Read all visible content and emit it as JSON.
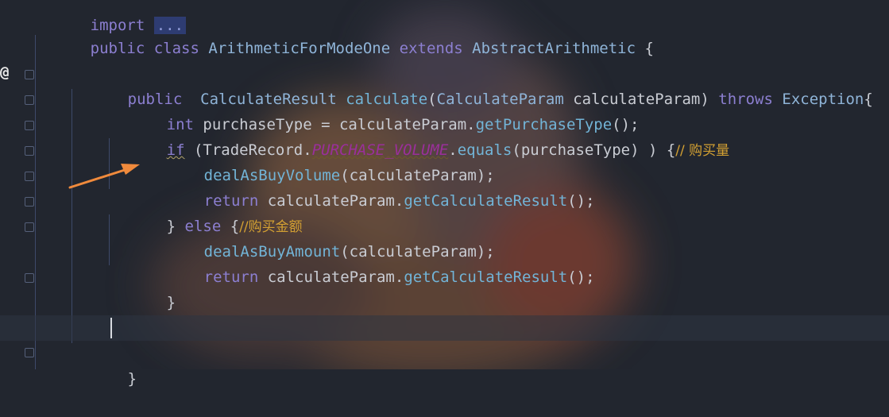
{
  "editor": {
    "gutter": {
      "override_marker": "@"
    },
    "lines": {
      "import": {
        "kw": "import",
        "folded": "..."
      },
      "class_decl": {
        "kw1": "public",
        "kw2": "class",
        "name": "ArithmeticForModeOne",
        "kw3": "extends",
        "base": "AbstractArithmetic",
        "brace": " {"
      },
      "method_decl": {
        "kw": "public",
        "ret": "CalculateResult",
        "name": "calculate",
        "open": "(",
        "ptype": "CalculateParam",
        "pname": " calculateParam",
        "close": ")",
        "throws": "throws",
        "exc": "Exception",
        "brace": "{"
      },
      "line_int": {
        "kw": "int",
        "rest": " purchaseType = calculateParam.",
        "call": "getPurchaseType",
        "end": "();"
      },
      "line_if": {
        "kw": "if",
        "open": " (TradeRecord.",
        "const": "PURCHASE_VOLUME",
        "dot": ".",
        "call": "equals",
        "args": "(purchaseType) ) {",
        "comment": "// 购买量"
      },
      "line_deal_volume": {
        "call": "dealAsBuyVolume",
        "args": "(calculateParam);"
      },
      "line_return_1": {
        "kw": "return",
        "rest": " calculateParam.",
        "call": "getCalculateResult",
        "end": "();"
      },
      "line_else": {
        "brace": "} ",
        "kw": "else",
        "open": " {",
        "comment": "//购买金额"
      },
      "line_deal_amount": {
        "call": "dealAsBuyAmount",
        "args": "(calculateParam);"
      },
      "line_return_2": {
        "kw": "return",
        "rest": " calculateParam.",
        "call": "getCalculateResult",
        "end": "();"
      },
      "line_close_if": {
        "brace": "}"
      },
      "line_close_method": {
        "brace": "}"
      }
    }
  },
  "colors": {
    "background": "#22262f",
    "keyword": "#8c7fd1",
    "type": "#8fb4d8",
    "method": "#72b4d7",
    "constant": "#9a2f9a",
    "comment": "#d3a032",
    "annotation_arrow": "#f08a3c"
  }
}
